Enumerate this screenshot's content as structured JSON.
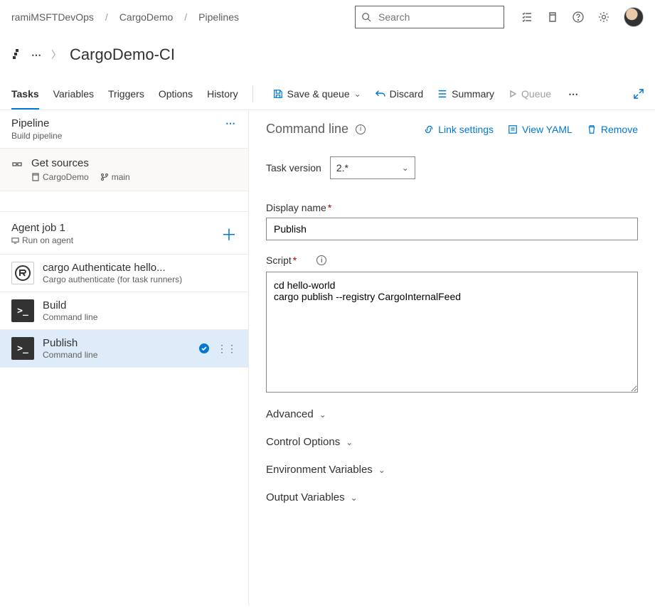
{
  "breadcrumb": [
    "ramiMSFTDevOps",
    "CargoDemo",
    "Pipelines"
  ],
  "search": {
    "placeholder": "Search"
  },
  "page_title": "CargoDemo-CI",
  "tabs": [
    "Tasks",
    "Variables",
    "Triggers",
    "Options",
    "History"
  ],
  "active_tab_index": 0,
  "toolbar": {
    "save_queue": "Save & queue",
    "discard": "Discard",
    "summary": "Summary",
    "queue": "Queue"
  },
  "left": {
    "pipeline": {
      "title": "Pipeline",
      "subtitle": "Build pipeline"
    },
    "get_sources": {
      "title": "Get sources",
      "repo": "CargoDemo",
      "branch": "main"
    },
    "agent": {
      "title": "Agent job 1",
      "subtitle": "Run on agent"
    },
    "tasks": [
      {
        "title": "cargo Authenticate hello...",
        "subtitle": "Cargo authenticate (for task runners)",
        "icon": "rust",
        "selected": false
      },
      {
        "title": "Build",
        "subtitle": "Command line",
        "icon": "cmd",
        "selected": false
      },
      {
        "title": "Publish",
        "subtitle": "Command line",
        "icon": "cmd",
        "selected": true
      }
    ]
  },
  "right": {
    "title": "Command line",
    "links": {
      "link_settings": "Link settings",
      "view_yaml": "View YAML",
      "remove": "Remove"
    },
    "task_version": {
      "label": "Task version",
      "value": "2.*"
    },
    "display_name": {
      "label": "Display name",
      "value": "Publish"
    },
    "script": {
      "label": "Script",
      "value": "cd hello-world\ncargo publish --registry CargoInternalFeed"
    },
    "sections": [
      "Advanced",
      "Control Options",
      "Environment Variables",
      "Output Variables"
    ]
  }
}
